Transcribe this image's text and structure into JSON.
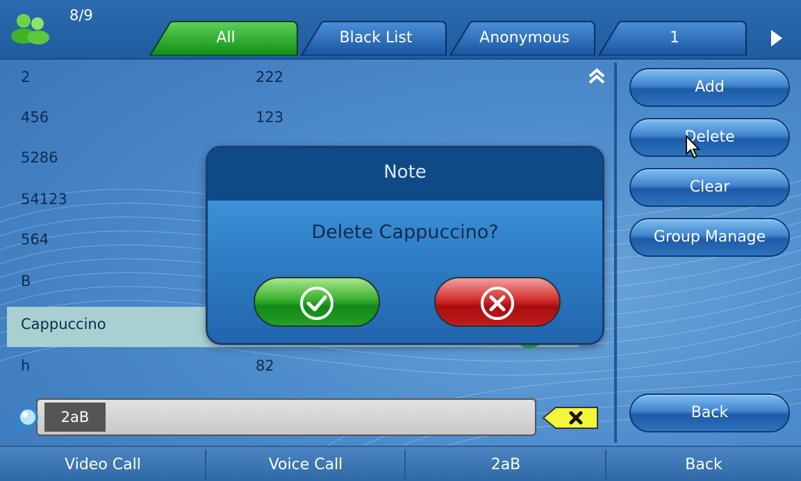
{
  "header": {
    "contact_count": "8/9",
    "tabs": [
      {
        "label": "All",
        "active": true
      },
      {
        "label": "Black List",
        "active": false
      },
      {
        "label": "Anonymous",
        "active": false
      },
      {
        "label": "1",
        "active": false
      }
    ]
  },
  "contacts": [
    {
      "name": "2",
      "number": "222"
    },
    {
      "name": "456",
      "number": "123"
    },
    {
      "name": "5286",
      "number": ""
    },
    {
      "name": "54123",
      "number": ""
    },
    {
      "name": "564",
      "number": ""
    },
    {
      "name": "B",
      "number": ""
    },
    {
      "name": "Cappuccino",
      "number": "",
      "selected": true
    },
    {
      "name": "h",
      "number": "82"
    }
  ],
  "search": {
    "value": "2aB"
  },
  "side_buttons": {
    "add": "Add",
    "delete": "Delete",
    "clear": "Clear",
    "group_manage": "Group Manage",
    "back": "Back"
  },
  "dialog": {
    "title": "Note",
    "message": "Delete  Cappuccino?"
  },
  "softkeys": [
    "Video Call",
    "Voice Call",
    "2aB",
    "Back"
  ],
  "colors": {
    "active_tab": "#1fa51f",
    "tab": "#1e5fae",
    "selected_row": "#a9d0d1",
    "confirm": "#1f9a22",
    "cancel": "#b81414"
  },
  "icons": [
    "contacts-icon",
    "next-arrow-icon",
    "scroll-up-icon",
    "search-icon",
    "clear-input-icon",
    "check-icon",
    "cancel-icon",
    "mouse-cursor-icon"
  ]
}
